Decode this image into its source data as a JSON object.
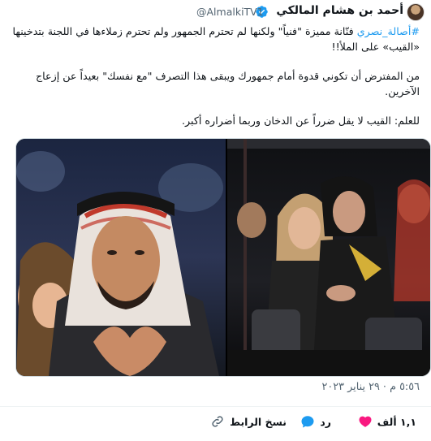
{
  "author": {
    "name": "أحمد بن هشام المالكي",
    "handle": "@AlmalkiTV1"
  },
  "tweet": {
    "hashtag": "#أصالة_نصري",
    "paragraphs": [
      " فنّانة مميزة \"فنياً\" ولكنها لم تحترم الجمهور ولم تحترم زملاءها في اللجنة بتدخينها «القيب» على الملأ!!",
      "من المفترض أن تكوني قدوة أمام جمهورك ويبقى هذا التصرف \"مع نفسك\" بعيداً عن إزعاج الآخرين.",
      "للعلم: القيب لا يقل ضرراً عن الدخان وربما أضراره أكبر."
    ],
    "timestamp": "٥:٥٦ م · ٢٩ يناير ٢٠٢٣"
  },
  "actions": {
    "likes": "١,١ ألف",
    "reply_label": "رد",
    "copy_link_label": "نسخ الرابط"
  },
  "icons": {
    "verified": "verified-badge-icon",
    "like": "heart-icon",
    "reply": "reply-bubble-icon",
    "copy": "link-icon"
  },
  "colors": {
    "accent": "#1d9bf0",
    "like": "#f91880",
    "muted": "#536471"
  }
}
